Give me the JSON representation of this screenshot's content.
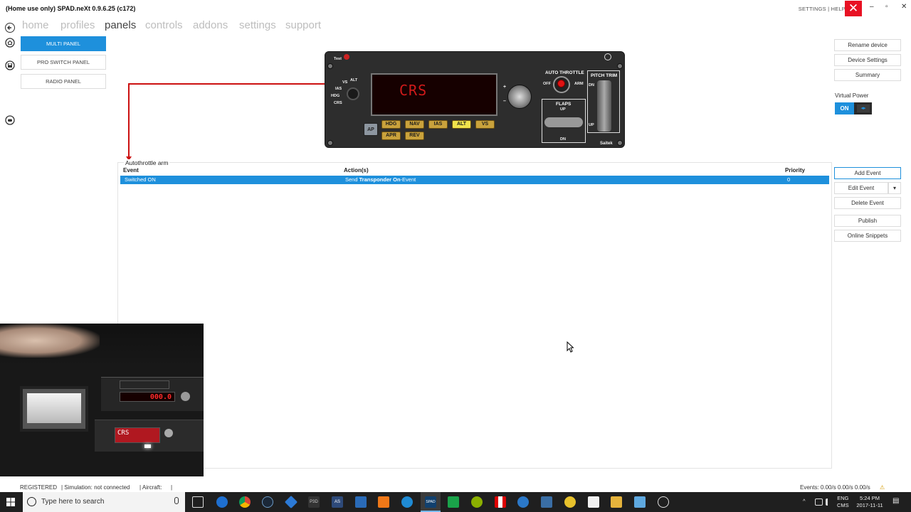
{
  "window": {
    "title": "(Home use only) SPAD.neXt 0.9.6.25 (c172)",
    "links": "SETTINGS | HELP",
    "close_glyph": "✕",
    "maximize_glyph": "▫",
    "minimize_glyph": "–"
  },
  "nav": {
    "items": [
      "home",
      "profiles",
      "panels",
      "controls",
      "addons",
      "settings",
      "support"
    ],
    "active_index": 2
  },
  "devices": [
    "MULTI PANEL",
    "PRO SWITCH PANEL",
    "RADIO PANEL"
  ],
  "panel": {
    "display_text": "CRS",
    "labels": {
      "test": "Test",
      "vs": "VS",
      "alt": "ALT",
      "ias": "IAS",
      "hdg": "HDG",
      "crs": "CRS",
      "plus": "+",
      "minus": "–",
      "auto_throttle": "AUTO THROTTLE",
      "off": "OFF",
      "arm": "ARM",
      "pitch_trim": "PITCH TRIM",
      "dn": "DN",
      "up": "UP",
      "flaps": "FLAPS",
      "flaps_up": "UP",
      "flaps_dn": "DN",
      "brand": "Saitek",
      "ap": "AP"
    },
    "buttons_row1": [
      "HDG",
      "NAV",
      "IAS",
      "ALT",
      "VS"
    ],
    "buttons_row2": [
      "APR",
      "REV"
    ],
    "lit_button": "ALT"
  },
  "side_buttons": [
    "Rename device",
    "Device Settings",
    "Summary"
  ],
  "virtual_power": {
    "label": "Virtual Power",
    "state": "ON",
    "thumb": "◂▸"
  },
  "event_buttons": [
    "Add Event",
    "Edit Event",
    "Delete Event",
    "Publish",
    "Online Snippets"
  ],
  "edit_event_arrow": "▾",
  "event_group": {
    "title": "Autothrottle arm",
    "columns": [
      "Event",
      "Action(s)",
      "Priority"
    ],
    "rows": [
      {
        "event": "Switched ON",
        "action_prefix": "Send ",
        "action_bold": "Transponder On",
        "action_suffix": "-Event",
        "priority": "0"
      }
    ]
  },
  "webcam": {
    "display_digits": "000.0",
    "display_text": "CRS"
  },
  "status": {
    "registered": "REGISTERED",
    "simulation": "| Simulation: not connected",
    "aircraft": "| Aircraft:",
    "aircraft_value": "|",
    "events": "Events: 0.00/s 0.00/s 0.00/s",
    "warning_glyph": "⚠"
  },
  "taskbar": {
    "search_placeholder": "Type here to search",
    "p3d_label": "P3D",
    "as_label": "AS",
    "spad_label": "SPAD",
    "language_top": "ENG",
    "language_bottom": "CMS",
    "time": "5:24 PM",
    "date": "2017-11-11",
    "tray_chevron": "^",
    "notification_badge": "▤"
  },
  "colors": {
    "accent": "#1e90dc",
    "close": "#e81123",
    "connector": "#cc1111"
  }
}
